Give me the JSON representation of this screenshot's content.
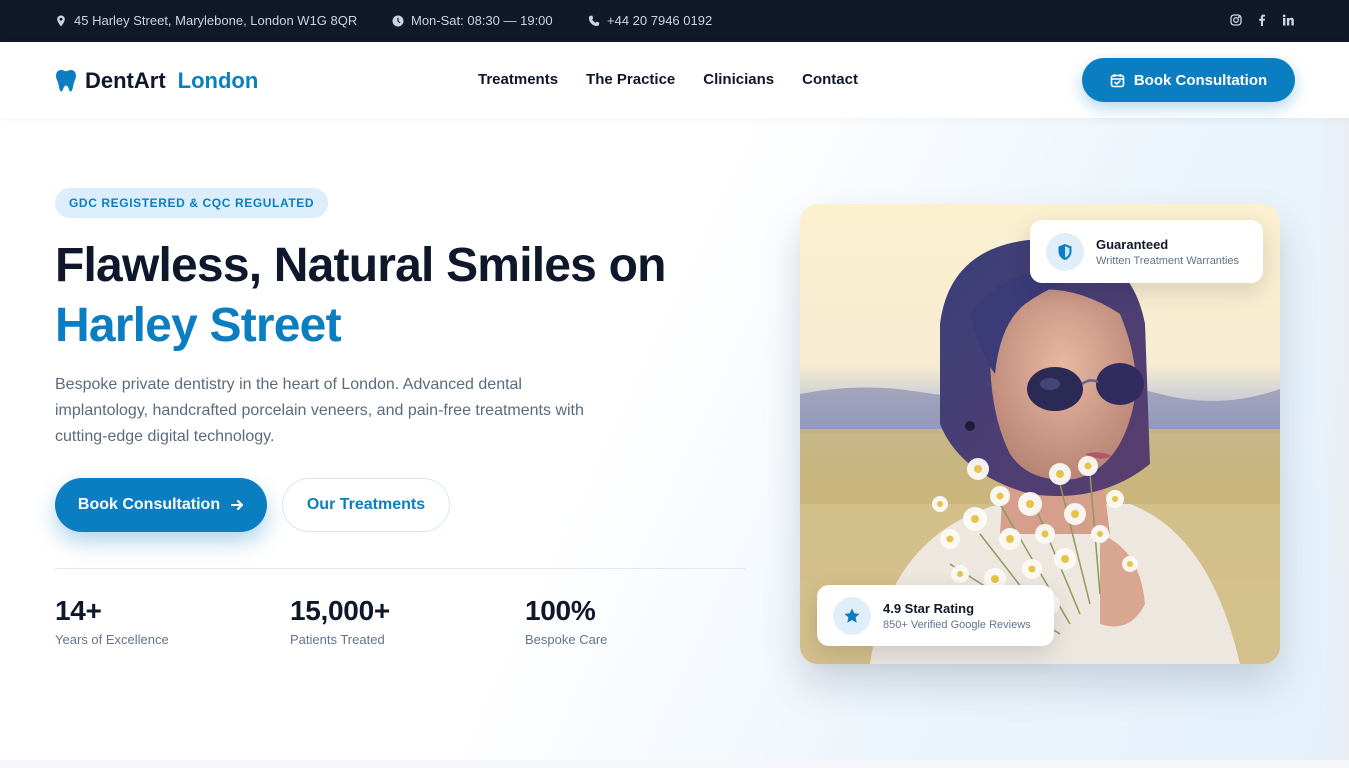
{
  "topbar": {
    "address": "45 Harley Street, Marylebone, London W1G 8QR",
    "hours": "Mon-Sat: 08:30 — 19:00",
    "phone": "+44 20 7946 0192",
    "social": [
      "instagram-icon",
      "facebook-icon",
      "linkedin-icon"
    ]
  },
  "nav": {
    "logo_primary": "DentArt",
    "logo_accent": "London",
    "menu": [
      "Treatments",
      "The Practice",
      "Clinicians",
      "Contact"
    ],
    "cta": "Book Consultation"
  },
  "hero": {
    "badge": "GDC REGISTERED & CQC REGULATED",
    "title_line1": "Flawless, Natural Smiles on",
    "title_line2": "Harley Street",
    "lead": "Bespoke private dentistry in the heart of London. Advanced dental implantology, handcrafted porcelain veneers, and pain-free treatments with cutting-edge digital technology.",
    "primary_cta": "Book Consultation",
    "secondary_cta": "Our Treatments",
    "stats": [
      {
        "value": "14+",
        "label": "Years of Excellence"
      },
      {
        "value": "15,000+",
        "label": "Patients Treated"
      },
      {
        "value": "100%",
        "label": "Bespoke Care"
      }
    ]
  },
  "cards": {
    "guarantee": {
      "title": "Guaranteed",
      "subtitle": "Written Treatment Warranties"
    },
    "rating": {
      "title": "4.9 Star Rating",
      "subtitle": "850+ Verified Google Reviews"
    }
  },
  "colors": {
    "brand": "#0b7ec2",
    "dark": "#0f172a",
    "topbar": "#111827"
  }
}
